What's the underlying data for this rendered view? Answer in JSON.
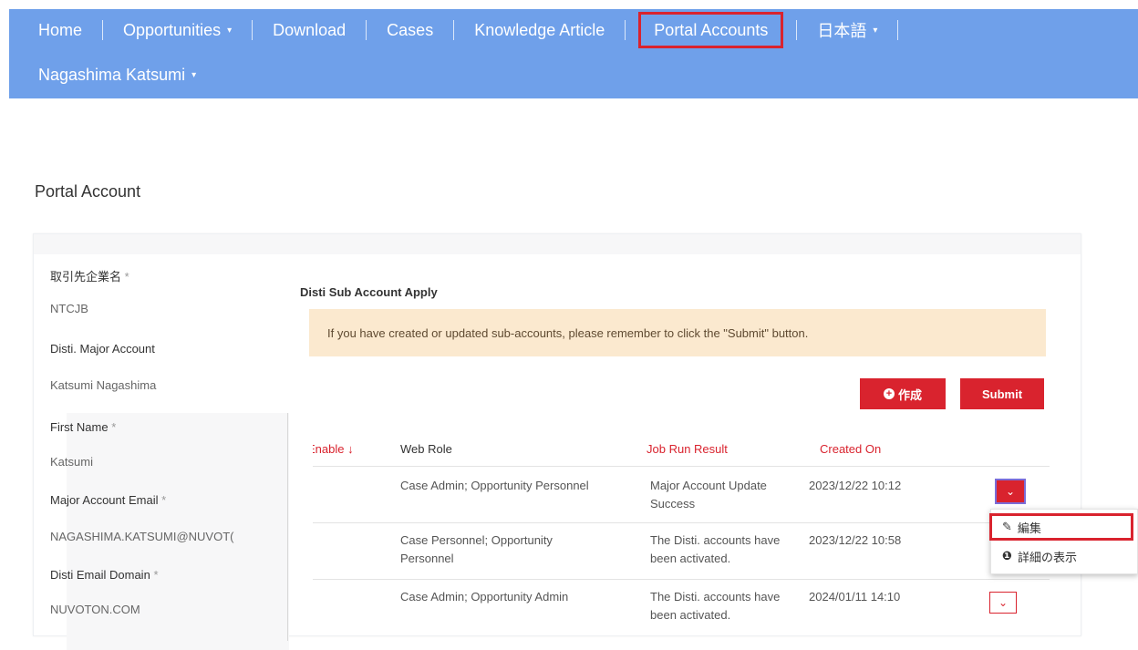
{
  "nav": {
    "items": [
      {
        "label": "Home"
      },
      {
        "label": "Opportunities"
      },
      {
        "label": "Download"
      },
      {
        "label": "Cases"
      },
      {
        "label": "Knowledge Article"
      },
      {
        "label": "Portal Accounts"
      },
      {
        "label": "日本語"
      }
    ],
    "user": "Nagashima Katsumi",
    "caret": "▾"
  },
  "page": {
    "title": "Portal Account"
  },
  "form": {
    "company_label": "取引先企業名",
    "company_value": "NTCJB",
    "major_account_label": "Disti. Major Account",
    "major_account_value": "Katsumi  Nagashima",
    "first_name_label": "First Name",
    "first_name_value": "Katsumi",
    "email_label": "Major Account Email",
    "email_value": "NAGASHIMA.KATSUMI@NUVOT(",
    "domain_label": "Disti Email Domain",
    "domain_value": "NUVOTON.COM",
    "required_mark": "*"
  },
  "sub_account": {
    "title": "Disti Sub Account Apply",
    "notice": "If you have created or updated sub-accounts, please remember to click the \"Submit\" button.",
    "create_label": "作成",
    "submit_label": "Submit"
  },
  "table": {
    "headers": {
      "enable": "Enable",
      "web_role": "Web Role",
      "job_run_result": "Job Run Result",
      "created_on": "Created On"
    },
    "rows": [
      {
        "web_role": "Case Admin; Opportunity Personnel",
        "job_result_1": "Major Account Update",
        "job_result_2": "Success",
        "created_on": "2023/12/22 10:12"
      },
      {
        "web_role_1": "Case Personnel; Opportunity",
        "web_role_2": "Personnel",
        "job_result_1": "The Disti. accounts have",
        "job_result_2": "been activated.",
        "created_on": "2023/12/22 10:58"
      },
      {
        "web_role": "Case Admin; Opportunity Admin",
        "job_result_1": "The Disti. accounts have",
        "job_result_2": "been activated.",
        "created_on": "2024/01/11 14:10"
      }
    ]
  },
  "dropdown": {
    "edit_label": "編集",
    "details_label": "詳細の表示"
  },
  "colors": {
    "navbar": "#6fa0ea",
    "accent_red": "#d9232e",
    "notice_bg": "#fbe9cf"
  }
}
